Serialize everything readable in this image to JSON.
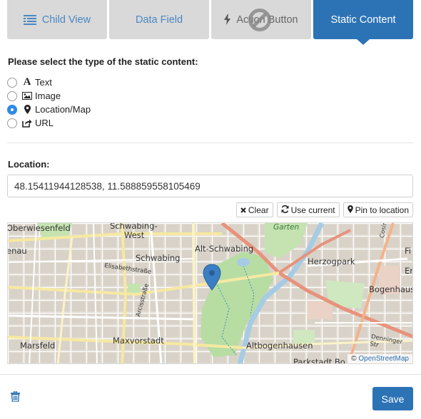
{
  "tabs": [
    {
      "label": "Child View",
      "icon": "list-icon",
      "state": "normal"
    },
    {
      "label": "Data Field",
      "icon": "",
      "state": "normal"
    },
    {
      "label": "Action Button",
      "icon": "bolt-icon",
      "state": "disabled"
    },
    {
      "label": "Static Content",
      "icon": "",
      "state": "active"
    }
  ],
  "static_type": {
    "heading": "Please select the type of the static content:",
    "options": [
      {
        "label": "Text",
        "icon": "font-icon",
        "checked": false
      },
      {
        "label": "Image",
        "icon": "image-icon",
        "checked": false
      },
      {
        "label": "Location/Map",
        "icon": "map-marker-icon",
        "checked": true
      },
      {
        "label": "URL",
        "icon": "external-link-icon",
        "checked": false
      }
    ]
  },
  "location": {
    "label": "Location:",
    "value": "48.15411944128538, 11.588859558105469"
  },
  "map_buttons": {
    "clear": "Clear",
    "use_current": "Use current",
    "pin": "Pin to location"
  },
  "map": {
    "labels": {
      "oberwiesenfeld": "Oberwiesenfeld",
      "schwabing_west_1": "Schwabing-",
      "schwabing_west_2": "West",
      "garten": "Garten",
      "enau": "enau",
      "alt_schwabing": "Alt-Schwabing",
      "schwabing": "Schwabing",
      "herzogpark": "Herzogpark",
      "elisabethstrasse": "Elisabethstraße",
      "bogenhaus": "Bogenhaus",
      "arcisstrasse": "Arcisstraße",
      "marsfeld": "Marsfeld",
      "maxvorstadt": "Maxvorstadt",
      "altbogenhausen": "Altbogenhausen",
      "deninger": "Denninger Str",
      "parkstadt": "Parkstadt Bo",
      "fi": "Fi",
      "er": "Er",
      "cosima": "Cosima"
    },
    "attribution_symbol": "©",
    "attribution": "OpenStreetMap"
  },
  "footer": {
    "save": "Save"
  },
  "colors": {
    "primary": "#2c73b6",
    "radio_checked": "#2c8ae8",
    "marker": "#3a7fc4",
    "park": "#b7dda3",
    "river": "#a6cbe5",
    "highway": "#e8927c"
  }
}
